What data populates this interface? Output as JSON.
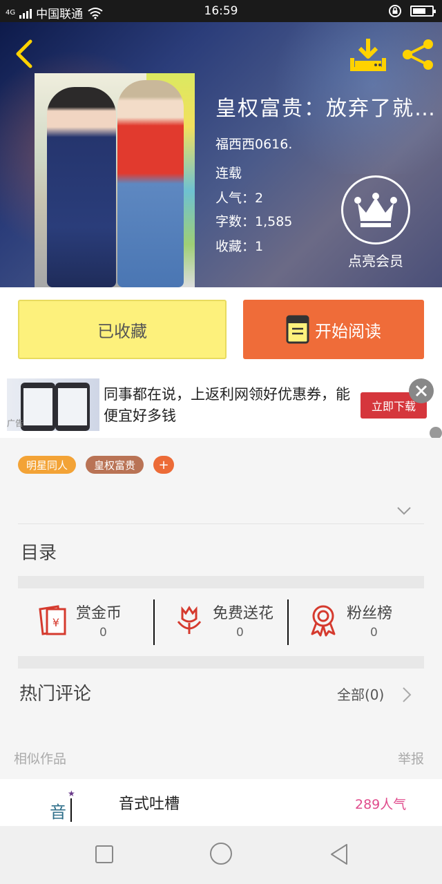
{
  "status_bar": {
    "carrier": "中国联通",
    "network": "4G",
    "time": "16:59"
  },
  "book": {
    "title": "皇权富贵：放弃了就…",
    "author": "福西西0616.",
    "status": "连载",
    "popularity": "人气：2",
    "word_count": "字数：1,585",
    "favorites": "收藏：1",
    "vip_label": "点亮会员"
  },
  "actions": {
    "collect_label": "已收藏",
    "read_label": "开始阅读"
  },
  "ad": {
    "text": "同事都在说，上返利网领好优惠券，能便宜好多钱",
    "button": "立即下载",
    "tag": "广告"
  },
  "tags": {
    "items": [
      "明星同人",
      "皇权富贵"
    ],
    "add": "+"
  },
  "toc_label": "目录",
  "stats": {
    "reward": {
      "label": "赏金币",
      "value": "0"
    },
    "flower": {
      "label": "免费送花",
      "value": "0"
    },
    "fans": {
      "label": "粉丝榜",
      "value": "0"
    }
  },
  "comments": {
    "label": "热门评论",
    "all": "全部(0)"
  },
  "similar": {
    "label": "相似作品",
    "report": "举报",
    "items": [
      {
        "icon_text": "音",
        "title": "音式吐槽",
        "popularity": "289人气"
      }
    ]
  },
  "colors": {
    "collect_bg": "#fdf17c",
    "read_bg": "#ef6c39",
    "ad_button": "#d5363c",
    "tag1": "#f3a336",
    "tag2": "#b97355",
    "popularity_pink": "#e04b8c"
  },
  "icons": [
    "back-icon",
    "download-icon",
    "share-icon",
    "crown-icon",
    "book-icon",
    "close-icon",
    "chevron-down-icon",
    "red-envelope-icon",
    "flower-icon",
    "medal-icon",
    "chevron-right-icon"
  ]
}
